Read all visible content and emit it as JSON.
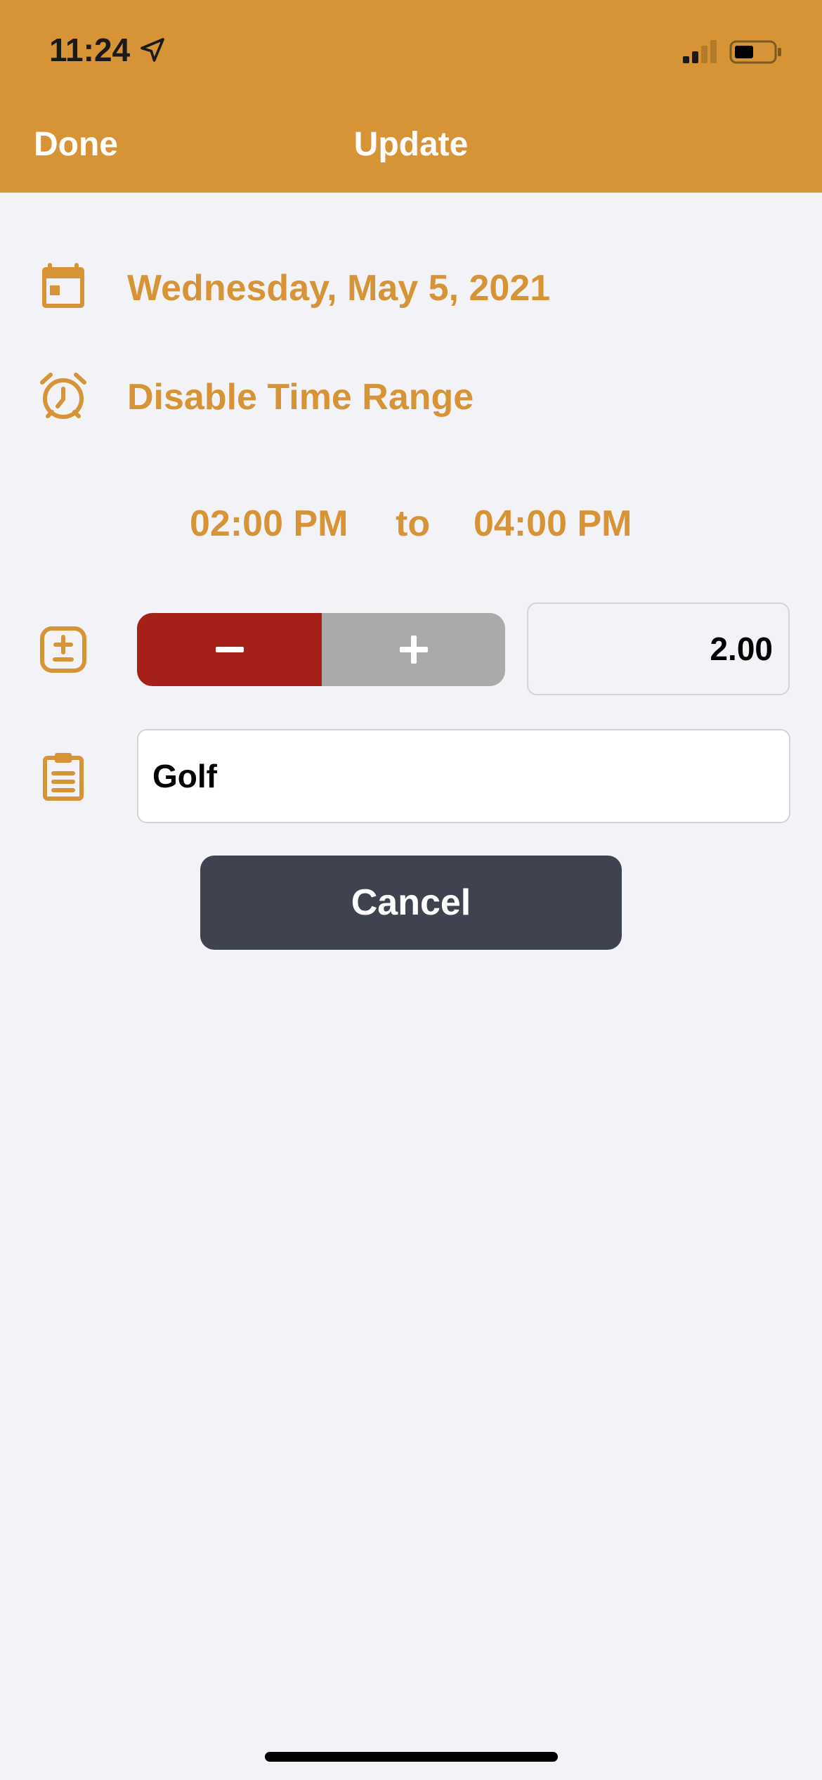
{
  "status_bar": {
    "time": "11:24"
  },
  "nav": {
    "done_label": "Done",
    "title": "Update"
  },
  "form": {
    "date": "Wednesday, May 5, 2021",
    "time_range_toggle": "Disable Time Range",
    "time_from": "02:00 PM",
    "time_separator": "to",
    "time_to": "04:00 PM",
    "quantity": "2.00",
    "note": "Golf",
    "cancel_label": "Cancel"
  },
  "colors": {
    "accent": "#d69436",
    "decrement": "#a52018",
    "increment": "#aaaaaa",
    "cancel_button": "#3f4350",
    "background": "#f2f2f7"
  },
  "icons": [
    "location-arrow-icon",
    "signal-icon",
    "battery-icon",
    "calendar-icon",
    "alarm-clock-icon",
    "plus-minus-icon",
    "minus-icon",
    "plus-icon",
    "clipboard-icon"
  ]
}
